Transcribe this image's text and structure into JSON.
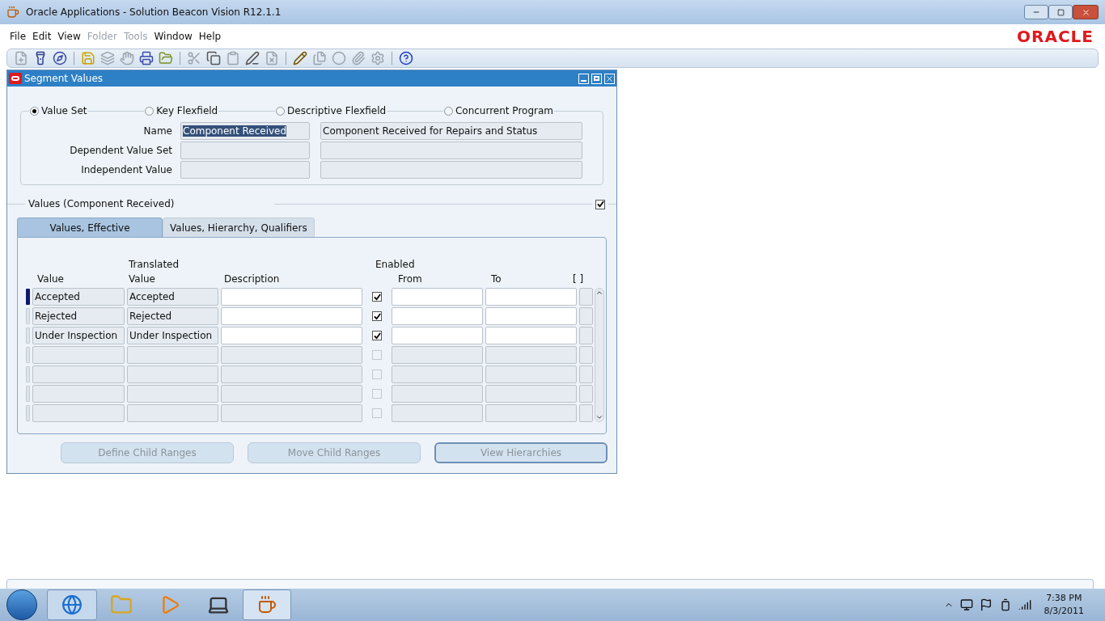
{
  "window": {
    "title": "Oracle Applications - Solution Beacon Vision R12.1.1"
  },
  "menu": [
    {
      "label": "File",
      "disabled": false
    },
    {
      "label": "Edit",
      "disabled": false
    },
    {
      "label": "View",
      "disabled": false
    },
    {
      "label": "Folder",
      "disabled": true
    },
    {
      "label": "Tools",
      "disabled": true
    },
    {
      "label": "Window",
      "disabled": false
    },
    {
      "label": "Help",
      "disabled": false
    }
  ],
  "brand": "ORACLE",
  "form": {
    "title": "Segment Values",
    "radios": [
      {
        "label": "Value Set",
        "selected": true
      },
      {
        "label": "Key Flexfield",
        "selected": false
      },
      {
        "label": "Descriptive Flexfield",
        "selected": false
      },
      {
        "label": "Concurrent Program",
        "selected": false
      }
    ],
    "fields": [
      {
        "label": "Name",
        "value": "Component Received",
        "description": "Component Received for Repairs and Status",
        "highlighted": true
      },
      {
        "label": "Dependent Value Set"
      },
      {
        "label": "Independent Value"
      }
    ],
    "section": {
      "label": "Values (Component Received)",
      "checked": true
    },
    "tabs": [
      {
        "label": "Values, Effective",
        "selected": true
      },
      {
        "label": "Values, Hierarchy, Qualifiers",
        "selected": false
      }
    ],
    "columns": {
      "value": "Value",
      "translated_value": "Translated Value",
      "description": "Description",
      "enabled": "Enabled",
      "from": "From",
      "to": "To",
      "flex": "[ ]"
    },
    "rows": [
      {
        "kind": "record",
        "current": true,
        "value": "Accepted",
        "translated_value": "Accepted",
        "enabled": true
      },
      {
        "kind": "record",
        "current": false,
        "value": "Rejected",
        "translated_value": "Rejected",
        "enabled": true
      },
      {
        "kind": "record",
        "current": false,
        "value": "Under Inspection",
        "translated_value": "Under Inspection",
        "enabled": true
      },
      {
        "kind": "empty",
        "current": false,
        "enabled": false
      },
      {
        "kind": "empty",
        "current": false,
        "enabled": false
      },
      {
        "kind": "empty",
        "current": false,
        "enabled": false
      },
      {
        "kind": "empty",
        "current": false,
        "enabled": false
      }
    ],
    "buttons": [
      {
        "label": "Define Child Ranges",
        "default": false
      },
      {
        "label": "Move Child Ranges",
        "default": false
      },
      {
        "label": "View Hierarchies",
        "default": true
      }
    ]
  },
  "taskbar": {
    "time": "7:38 PM",
    "date": "8/3/2011"
  }
}
